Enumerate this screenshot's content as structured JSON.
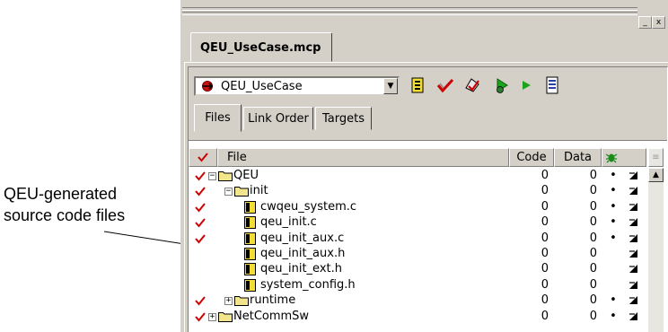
{
  "callout": {
    "lines": [
      "QEU-generated",
      "source code files"
    ]
  },
  "window": {
    "doc_tab": "QEU_UseCase.mcp",
    "minimize_glyph": "_",
    "close_glyph": "x"
  },
  "toolbar": {
    "target": "QEU_UseCase",
    "buttons": [
      "settings-icon",
      "make-check-icon",
      "synchronize-icon",
      "debug-icon",
      "run-icon",
      "project-inspector-icon"
    ]
  },
  "tabs": [
    "Files",
    "Link Order",
    "Targets"
  ],
  "columns": {
    "file": "File",
    "code": "Code",
    "data": "Data"
  },
  "rows": [
    {
      "name": "QEU",
      "type": "folder",
      "code": "0",
      "data": "0",
      "checked": true,
      "dot": "•",
      "expander": "⊟",
      "level": 0
    },
    {
      "name": "init",
      "type": "folder",
      "code": "0",
      "data": "0",
      "checked": true,
      "dot": "•",
      "expander": "⊟",
      "level": 1
    },
    {
      "name": "cwqeu_system.c",
      "type": "file",
      "code": "0",
      "data": "0",
      "checked": true,
      "dot": "•",
      "level": 2
    },
    {
      "name": "qeu_init.c",
      "type": "file",
      "code": "0",
      "data": "0",
      "checked": true,
      "dot": "•",
      "level": 2
    },
    {
      "name": "qeu_init_aux.c",
      "type": "file",
      "code": "0",
      "data": "0",
      "checked": true,
      "dot": "•",
      "level": 2
    },
    {
      "name": "qeu_init_aux.h",
      "type": "file",
      "code": "0",
      "data": "0",
      "checked": false,
      "dot": "",
      "level": 2
    },
    {
      "name": "qeu_init_ext.h",
      "type": "file",
      "code": "0",
      "data": "0",
      "checked": false,
      "dot": "",
      "level": 2
    },
    {
      "name": "system_config.h",
      "type": "file",
      "code": "0",
      "data": "0",
      "checked": false,
      "dot": "",
      "level": 2
    },
    {
      "name": "runtime",
      "type": "folder",
      "code": "0",
      "data": "0",
      "checked": true,
      "dot": "•",
      "expander": "⊞",
      "level": 1
    },
    {
      "name": "NetCommSw",
      "type": "folder",
      "code": "0",
      "data": "0",
      "checked": true,
      "dot": "•",
      "expander": "⊞",
      "level": 0
    }
  ],
  "colors": {
    "check": "#cc0000",
    "folder": "#f2e58c",
    "file_yellow": "#f4dc36",
    "run_green": "#1ca51c"
  }
}
